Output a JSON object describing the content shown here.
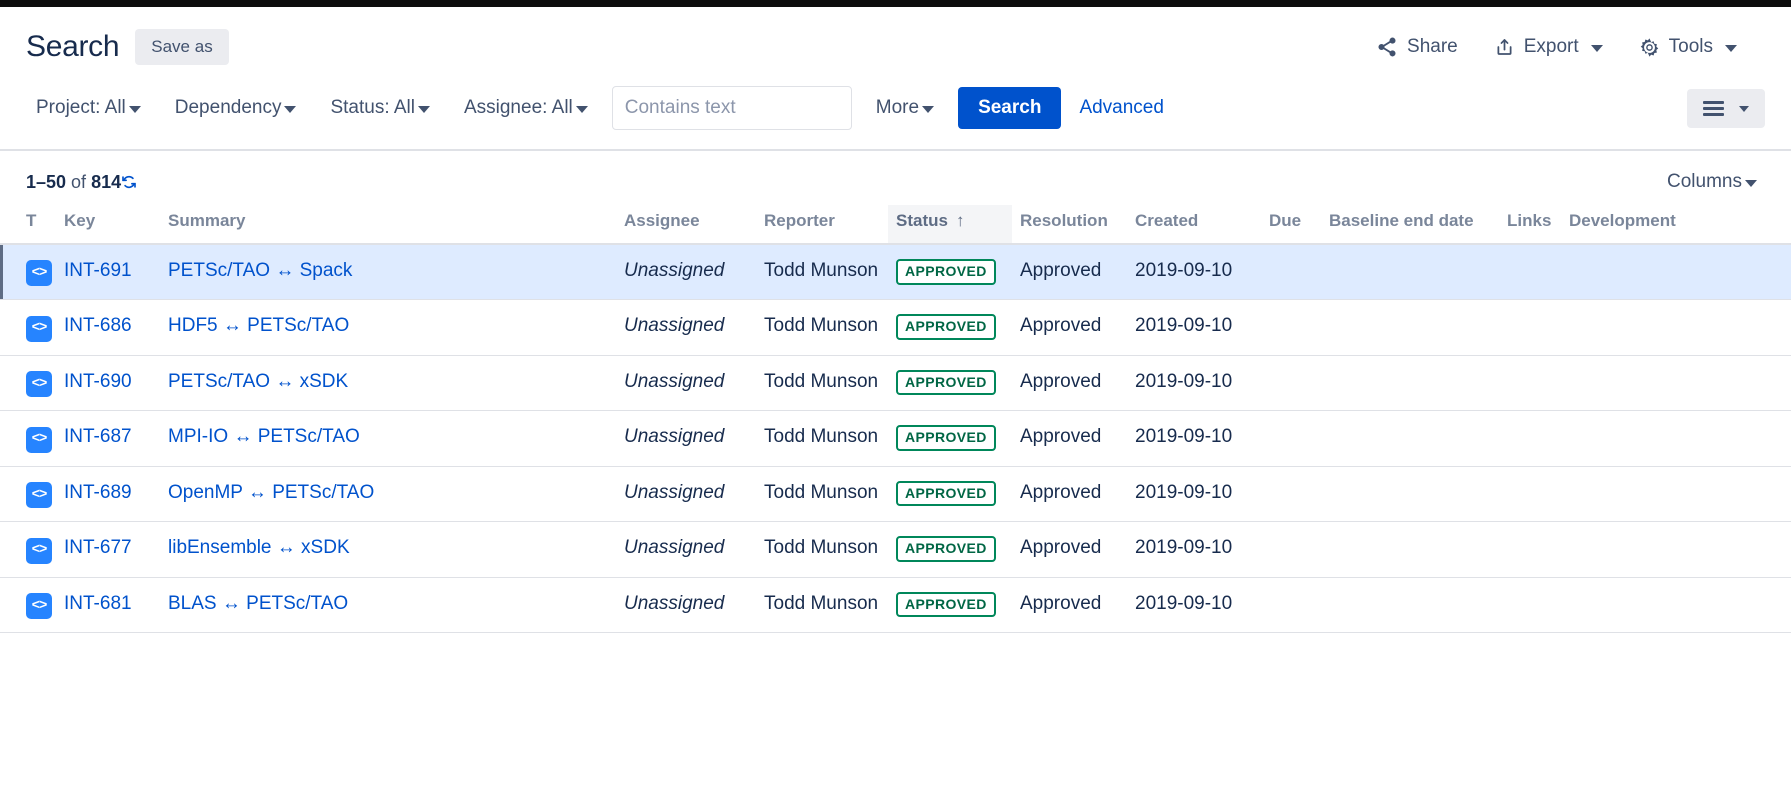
{
  "header": {
    "title": "Search",
    "save_as_label": "Save as",
    "actions": [
      {
        "label": "Share",
        "icon": "share-icon",
        "has_caret": false
      },
      {
        "label": "Export",
        "icon": "export-icon",
        "has_caret": true
      },
      {
        "label": "Tools",
        "icon": "gear-icon",
        "has_caret": true
      }
    ]
  },
  "filters": {
    "project": "Project: All",
    "dependency": "Dependency",
    "status": "Status: All",
    "assignee": "Assignee: All",
    "contains_placeholder": "Contains text",
    "contains_value": "",
    "more": "More",
    "search_button": "Search",
    "advanced_link": "Advanced",
    "view_toggle_icon": "hamburger-icon"
  },
  "results": {
    "range_prefix": "1–50",
    "of_text": " of ",
    "total": "814",
    "refresh_icon": "refresh-icon",
    "columns_label": "Columns"
  },
  "table": {
    "columns": [
      "T",
      "Key",
      "Summary",
      "Assignee",
      "Reporter",
      "Status",
      "Resolution",
      "Created",
      "Due",
      "Baseline end date",
      "Links",
      "Development"
    ],
    "sorted_column": "Status",
    "sort_direction": "↑",
    "rows": [
      {
        "type_icon": "subtask-code-icon",
        "key": "INT-691",
        "summary": "PETSc/TAO ↔ Spack",
        "assignee": "Unassigned",
        "reporter": "Todd Munson",
        "status": "APPROVED",
        "resolution": "Approved",
        "created": "2019-09-10",
        "due": "",
        "baseline_end_date": "",
        "links": "",
        "development": "",
        "selected": true
      },
      {
        "type_icon": "subtask-code-icon",
        "key": "INT-686",
        "summary": "HDF5 ↔ PETSc/TAO",
        "assignee": "Unassigned",
        "reporter": "Todd Munson",
        "status": "APPROVED",
        "resolution": "Approved",
        "created": "2019-09-10",
        "due": "",
        "baseline_end_date": "",
        "links": "",
        "development": "",
        "selected": false
      },
      {
        "type_icon": "subtask-code-icon",
        "key": "INT-690",
        "summary": "PETSc/TAO ↔ xSDK",
        "assignee": "Unassigned",
        "reporter": "Todd Munson",
        "status": "APPROVED",
        "resolution": "Approved",
        "created": "2019-09-10",
        "due": "",
        "baseline_end_date": "",
        "links": "",
        "development": "",
        "selected": false
      },
      {
        "type_icon": "subtask-code-icon",
        "key": "INT-687",
        "summary": "MPI-IO ↔ PETSc/TAO",
        "assignee": "Unassigned",
        "reporter": "Todd Munson",
        "status": "APPROVED",
        "resolution": "Approved",
        "created": "2019-09-10",
        "due": "",
        "baseline_end_date": "",
        "links": "",
        "development": "",
        "selected": false
      },
      {
        "type_icon": "subtask-code-icon",
        "key": "INT-689",
        "summary": "OpenMP ↔ PETSc/TAO",
        "assignee": "Unassigned",
        "reporter": "Todd Munson",
        "status": "APPROVED",
        "resolution": "Approved",
        "created": "2019-09-10",
        "due": "",
        "baseline_end_date": "",
        "links": "",
        "development": "",
        "selected": false
      },
      {
        "type_icon": "subtask-code-icon",
        "key": "INT-677",
        "summary": "libEnsemble ↔ xSDK",
        "assignee": "Unassigned",
        "reporter": "Todd Munson",
        "status": "APPROVED",
        "resolution": "Approved",
        "created": "2019-09-10",
        "due": "",
        "baseline_end_date": "",
        "links": "",
        "development": "",
        "selected": false
      },
      {
        "type_icon": "subtask-code-icon",
        "key": "INT-681",
        "summary": "BLAS ↔ PETSc/TAO",
        "assignee": "Unassigned",
        "reporter": "Todd Munson",
        "status": "APPROVED",
        "resolution": "Approved",
        "created": "2019-09-10",
        "due": "",
        "baseline_end_date": "",
        "links": "",
        "development": "",
        "selected": false
      }
    ]
  },
  "colors": {
    "primary_blue": "#0052cc",
    "link_blue": "#0052cc",
    "icon_blue": "#2684ff",
    "selected_row": "#deebff",
    "status_green": "#00875a",
    "text_dark": "#172b4d",
    "text_muted": "#7a869a"
  }
}
